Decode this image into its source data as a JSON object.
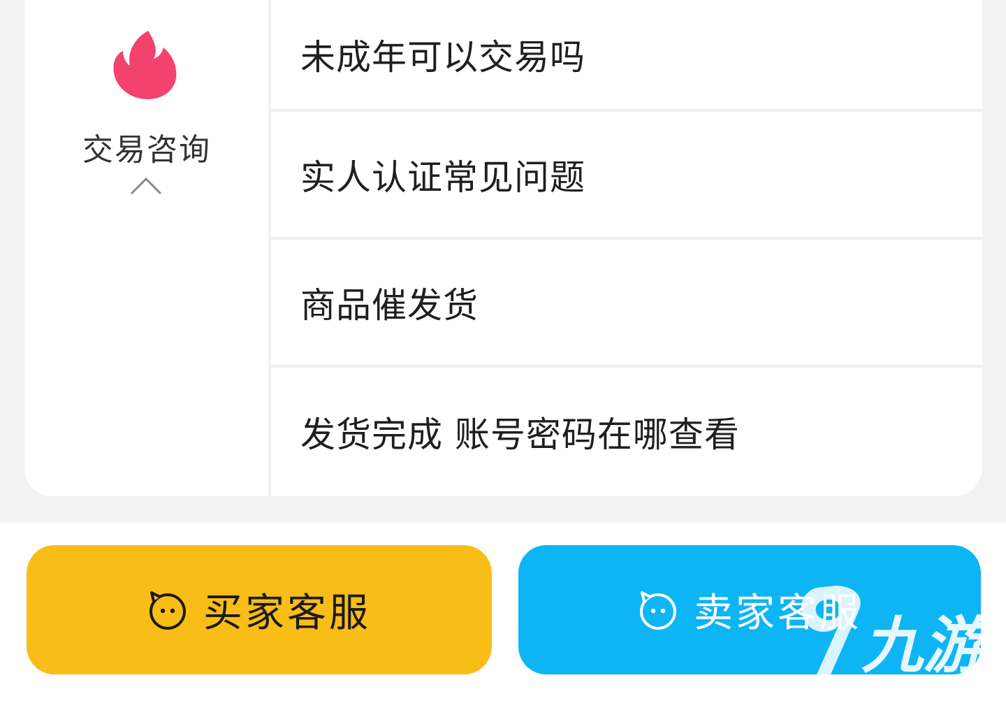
{
  "category": {
    "label": "交易咨询",
    "icon": "fire-icon",
    "icon_color": "#f2426e",
    "expanded": true
  },
  "faq": [
    {
      "label": "未成年可以交易吗"
    },
    {
      "label": "实人认证常见问题"
    },
    {
      "label": "商品催发货"
    },
    {
      "label": "发货完成 账号密码在哪查看"
    }
  ],
  "buttons": {
    "buyer": {
      "label": "买家客服",
      "icon": "service-face-icon",
      "color": "#f9bd17"
    },
    "seller": {
      "label": "卖家客服",
      "icon": "service-face-icon",
      "color": "#0db5f5"
    }
  },
  "watermark": {
    "text": "九游",
    "icon": "9you-logo-icon"
  }
}
